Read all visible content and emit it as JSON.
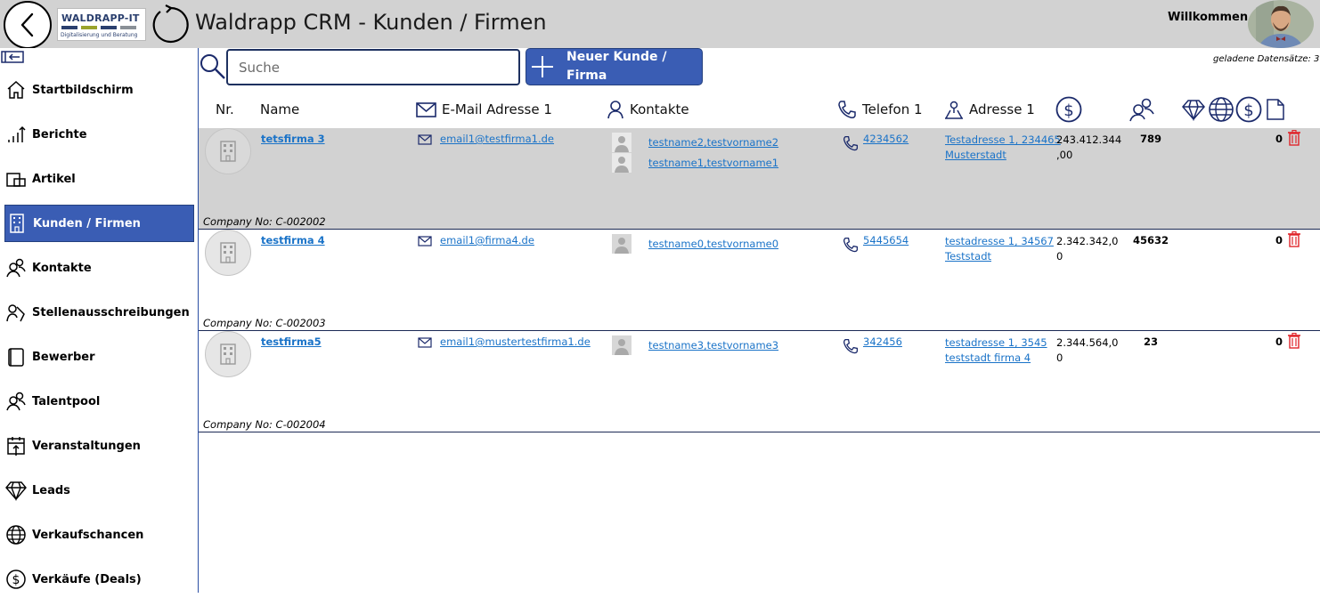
{
  "header": {
    "title": "Waldrapp CRM - Kunden / Firmen",
    "welcome": "Willkommen",
    "logo_title": "WALDRAPP-IT",
    "logo_subtitle": "Digitalisierung und Beratung"
  },
  "sidebar": {
    "items": [
      {
        "label": "Startbildschirm",
        "icon": "home-icon"
      },
      {
        "label": "Berichte",
        "icon": "chart-icon"
      },
      {
        "label": "Artikel",
        "icon": "article-icon"
      },
      {
        "label": "Kunden / Firmen",
        "icon": "building-icon",
        "active": true
      },
      {
        "label": "Kontakte",
        "icon": "contacts-icon"
      },
      {
        "label": "Stellenausschreibungen",
        "icon": "jobs-icon"
      },
      {
        "label": "Bewerber",
        "icon": "applicant-icon"
      },
      {
        "label": "Talentpool",
        "icon": "talentpool-icon"
      },
      {
        "label": "Veranstaltungen",
        "icon": "calendar-icon"
      },
      {
        "label": "Leads",
        "icon": "diamond-icon"
      },
      {
        "label": "Verkaufschancen",
        "icon": "globe-icon"
      },
      {
        "label": "Verkäufe (Deals)",
        "icon": "dollar-icon"
      }
    ]
  },
  "toolbar": {
    "search_placeholder": "Suche",
    "new_button": "Neuer Kunde /\nFirma",
    "loaded_records": "geladene Datensätze: 3"
  },
  "columns": {
    "nr": "Nr.",
    "name": "Name",
    "email": "E-Mail Adresse 1",
    "contacts": "Kontakte",
    "phone": "Telefon 1",
    "address": "Adresse 1"
  },
  "rows": [
    {
      "name": "tetsfirma 3",
      "email": "email1@testfirma1.de",
      "contacts": [
        "testname2,testvorname2",
        "testname1,testvorname1"
      ],
      "phone": "4234562",
      "address": "Testadresse 1, 234465 Musterstadt",
      "amount": "243.412.344,00",
      "count": "789",
      "zero": "0",
      "company_no": "Company No: C-002002"
    },
    {
      "name": "testfirma 4",
      "email": "email1@firma4.de",
      "contacts": [
        "testname0,testvorname0"
      ],
      "phone": "5445654",
      "address": "testadresse 1, 34567 Teststadt",
      "amount": "2.342.342,00",
      "count": "45632",
      "zero": "0",
      "company_no": "Company No: C-002003"
    },
    {
      "name": "testfirma5",
      "email": "email1@mustertestfirma1.de",
      "contacts": [
        "testname3,testvorname3"
      ],
      "phone": "342456",
      "address": "testadresse 1, 3545 teststadt firma 4",
      "amount": "2.344.564,00",
      "count": "23",
      "zero": "0",
      "company_no": "Company No: C-002004"
    }
  ],
  "colors": {
    "accent": "#3a5db4",
    "header_bg": "#d2d2d2",
    "link": "#1a73c8",
    "delete": "#e0242a",
    "icon_navy": "#1b2a6b"
  }
}
